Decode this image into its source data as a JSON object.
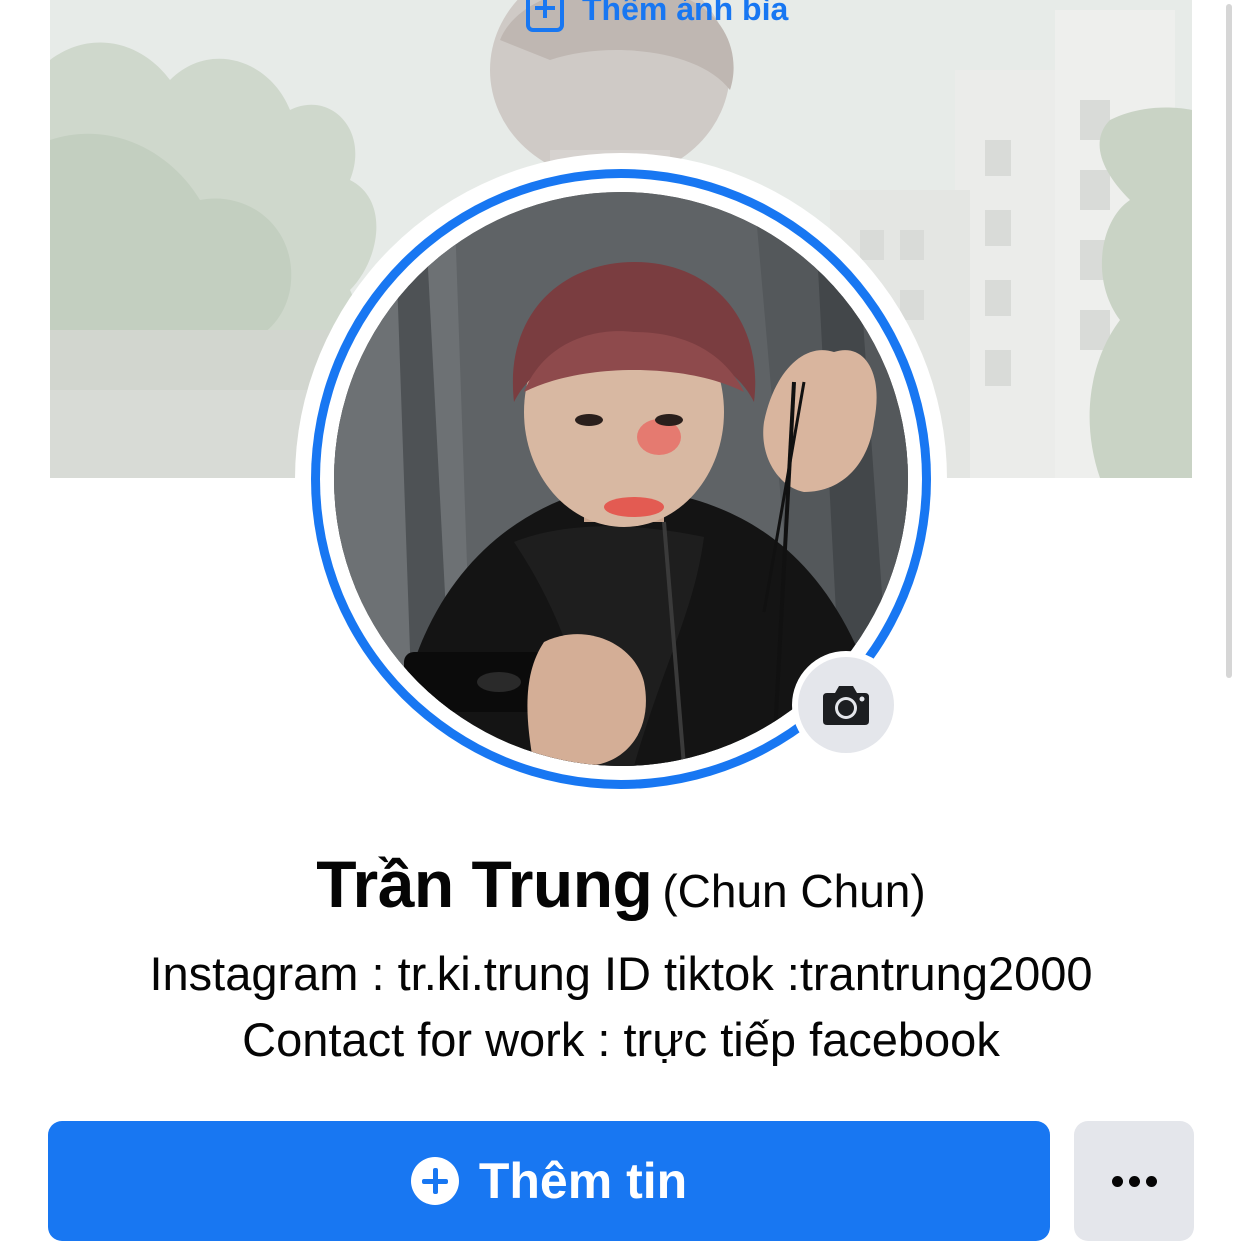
{
  "cover": {
    "action_label": "Thêm ảnh bìa",
    "action_icon": "add-photo-icon"
  },
  "profile": {
    "name": "Trần Trung",
    "alternate_name": "(Chun Chun)",
    "bio_line_1": "Instagram : tr.ki.trung ID tiktok :trantrung2000",
    "bio_line_2": "Contact for work : trực tiếp facebook",
    "avatar_story_ring_color": "#1877f2",
    "camera_icon": "camera-icon"
  },
  "actions": {
    "add_story_label": "Thêm tin",
    "add_story_icon": "plus-circle-icon",
    "more_icon": "more-dots-icon"
  },
  "colors": {
    "accent": "#1877f2",
    "secondary_button": "#e4e6eb",
    "text": "#050505"
  }
}
